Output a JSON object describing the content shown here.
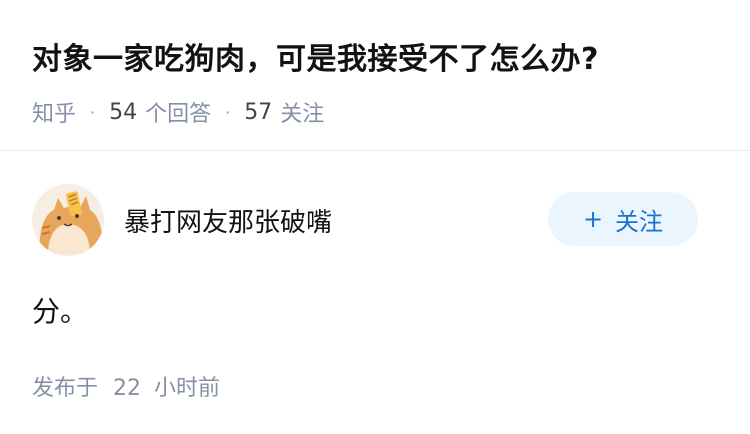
{
  "question": {
    "title": "对象一家吃狗肉，可是我接受不了怎么办?",
    "source": "知乎",
    "answer_count": "54",
    "answer_unit": "个回答",
    "follower_count": "57",
    "follower_unit": "关注"
  },
  "answer": {
    "author_name": "暴打网友那张破嘴",
    "follow_button": {
      "icon": "+",
      "label": "关注"
    },
    "content": "分。",
    "publish_label": "发布于",
    "publish_value": "22",
    "publish_unit": "小时前"
  },
  "colors": {
    "text_primary": "#121212",
    "text_secondary": "#8590a6",
    "brand_blue": "#1772d1",
    "button_bg": "#ebf5fd"
  }
}
